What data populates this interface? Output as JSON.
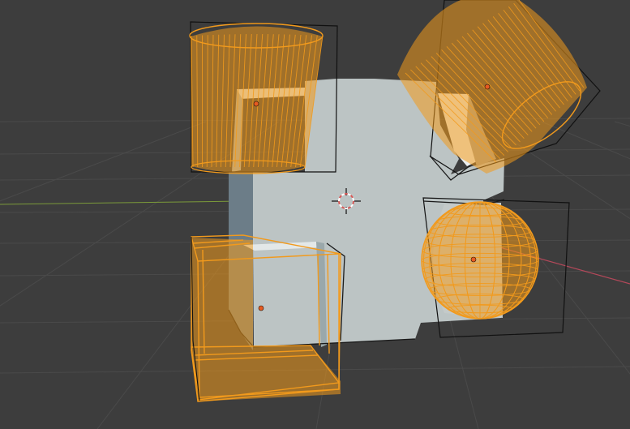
{
  "viewport": {
    "editor": "3D Viewport",
    "background_color": "#3d3d3d",
    "grid_color": "#4a4a4a",
    "x_axis_color": "#b4485a",
    "y_axis_color": "#7b9a3a"
  },
  "scene": {
    "base_object": {
      "name": "boolean-cube",
      "face_color": "#bcc4c4",
      "shadow_color": "#6c7d88"
    },
    "cutters": [
      {
        "name": "cylinder-upper-left",
        "shape": "cylinder"
      },
      {
        "name": "cylinder-upper-right",
        "shape": "cylinder"
      },
      {
        "name": "sphere-right",
        "shape": "uv-sphere"
      },
      {
        "name": "cube-lower-left",
        "shape": "cube"
      }
    ],
    "selection_color": "#f29a1c",
    "origin_color": "#e65b22"
  },
  "cursor": {
    "name": "3d-cursor",
    "ring_colors": [
      "#d85a58",
      "#ffffff"
    ]
  }
}
